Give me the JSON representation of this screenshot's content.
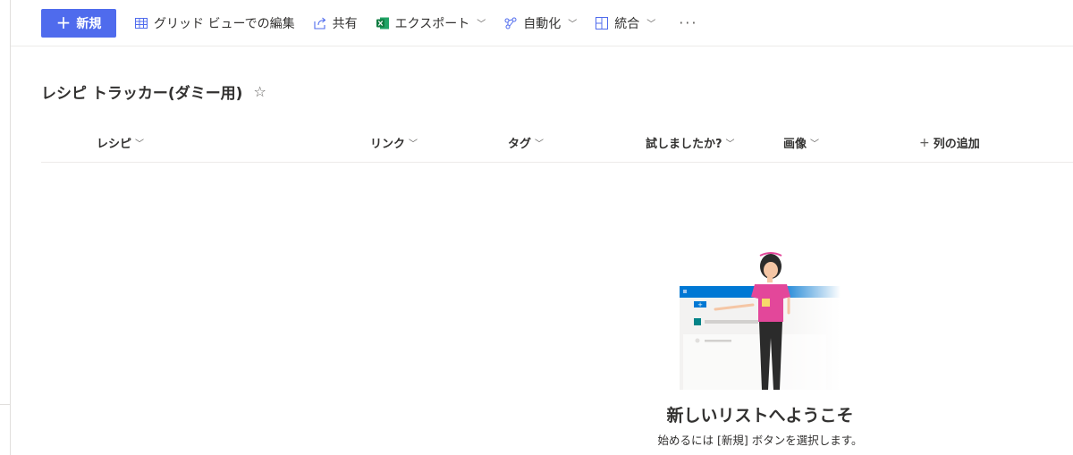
{
  "toolbar": {
    "new_label": "新規",
    "grid_view_label": "グリッド ビューでの編集",
    "share_label": "共有",
    "export_label": "エクスポート",
    "automate_label": "自動化",
    "integrate_label": "統合",
    "more_label": "···"
  },
  "list": {
    "title": "レシピ トラッカー(ダミー用)",
    "favorite_icon": "☆"
  },
  "columns": [
    {
      "label": "レシピ"
    },
    {
      "label": "リンク"
    },
    {
      "label": "タグ"
    },
    {
      "label": "試しましたか?"
    },
    {
      "label": "画像"
    }
  ],
  "add_column_label": "列の追加",
  "empty_state": {
    "heading": "新しいリストへようこそ",
    "subtext": "始めるには [新規] ボタンを選択します。"
  },
  "colors": {
    "accent": "#4f6bed",
    "excel_green": "#107c41",
    "brand_blue": "#0078d4",
    "figure_shirt": "#e3479a"
  }
}
